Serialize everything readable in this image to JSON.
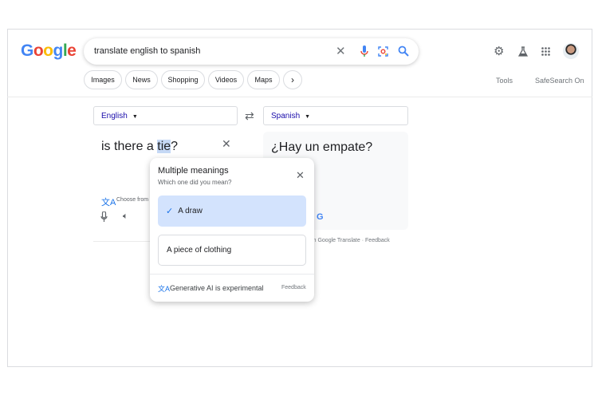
{
  "logo": "Google",
  "search": {
    "query": "translate english to spanish"
  },
  "header_icons": [
    "settings-icon",
    "labs-icon",
    "apps-icon",
    "avatar"
  ],
  "chips": [
    "Images",
    "News",
    "Shopping",
    "Videos",
    "Maps"
  ],
  "tools": "Tools",
  "safesearch": "SafeSearch On",
  "translate": {
    "source_lang": "English",
    "target_lang": "Spanish",
    "source_before": "is there a ",
    "source_highlight": "tie",
    "source_after": "?",
    "target_text": "¿Hay un empate?",
    "choose_from": "Choose from",
    "open_in": "Open in Google Translate",
    "dot": "·",
    "feedback": "Feedback"
  },
  "popup": {
    "title": "Multiple meanings",
    "subtitle": "Which one did you mean?",
    "options": [
      {
        "label": "A draw",
        "selected": true
      },
      {
        "label": "A piece of clothing",
        "selected": false
      }
    ],
    "footer": "Generative AI is experimental",
    "feedback": "Feedback"
  },
  "colors": {
    "accent": "#1a73e8",
    "selected_bg": "#d3e3fd"
  }
}
